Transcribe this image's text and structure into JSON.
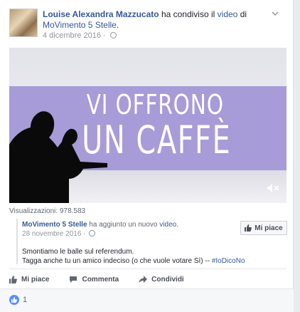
{
  "post": {
    "author": "Louise Alexandra Mazzucato",
    "verb": "ha condiviso il",
    "object": "video",
    "preposition": "di",
    "page": "MoVimento 5 Stelle",
    "date": "4 dicembre 2016 ·"
  },
  "video": {
    "banner_line1": "VI OFFRONO",
    "banner_line2": "UN CAFFÈ",
    "banner_color": "#a79bd8"
  },
  "views": "Visualizzazioni: 978.583",
  "shared": {
    "author": "MoVimento 5 Stelle",
    "verb": "ha aggiunto un nuovo",
    "object": "video.",
    "date": "28 novembre 2016 ·",
    "like_page_label": "Mi piace",
    "text_line1": "Smontiamo le balle sul referendum.",
    "text_line2": "Tagga anche tu un amico indeciso (o che vuole votare Sì) -- ",
    "hashtag": "#IoDicoNo"
  },
  "actions": {
    "like": "Mi piace",
    "comment": "Commenta",
    "share": "Condividi"
  },
  "reactions": {
    "count": "1"
  },
  "colors": {
    "link": "#365899",
    "like_blue": "#5890ff"
  }
}
